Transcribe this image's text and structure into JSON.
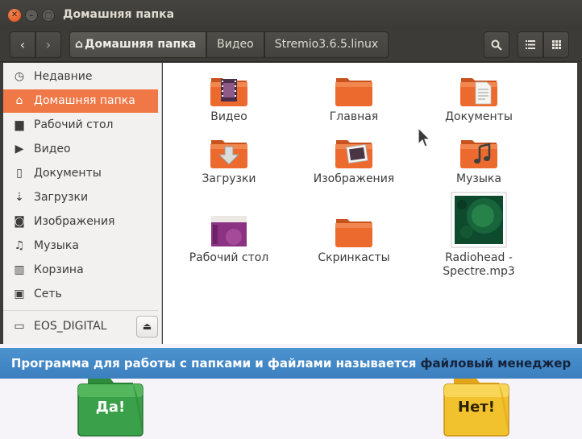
{
  "window": {
    "title": "Домашняя папка",
    "close_glyph": "✕",
    "min_glyph": "–",
    "max_glyph": "□"
  },
  "toolbar": {
    "back_glyph": "‹",
    "forward_glyph": "›",
    "breadcrumbs": [
      "Домашняя папка",
      "Видео",
      "Stremio3.6.5.linux"
    ],
    "home_glyph": "⌂"
  },
  "sidebar": {
    "items": [
      {
        "label": "Недавние",
        "icon": "clock-icon",
        "glyph": "◷"
      },
      {
        "label": "Домашняя папка",
        "icon": "home-icon",
        "glyph": "⌂"
      },
      {
        "label": "Рабочий стол",
        "icon": "desktop-icon",
        "glyph": "▆"
      },
      {
        "label": "Видео",
        "icon": "video-icon",
        "glyph": "▶"
      },
      {
        "label": "Документы",
        "icon": "document-icon",
        "glyph": "▯"
      },
      {
        "label": "Загрузки",
        "icon": "download-icon",
        "glyph": "⇣"
      },
      {
        "label": "Изображения",
        "icon": "camera-icon",
        "glyph": "◙"
      },
      {
        "label": "Музыка",
        "icon": "music-icon",
        "glyph": "♫"
      },
      {
        "label": "Корзина",
        "icon": "trash-icon",
        "glyph": "▥"
      },
      {
        "label": "Сеть",
        "icon": "network-icon",
        "glyph": "▣"
      }
    ],
    "device": {
      "label": "EOS_DIGITAL",
      "icon": "drive-icon",
      "glyph": "▭",
      "eject_glyph": "⏏"
    }
  },
  "files": [
    {
      "label": "Видео",
      "icon": "folder-video-icon"
    },
    {
      "label": "Главная",
      "icon": "folder-icon"
    },
    {
      "label": "Документы",
      "icon": "folder-documents-icon"
    },
    {
      "label": "Загрузки",
      "icon": "folder-downloads-icon"
    },
    {
      "label": "Изображения",
      "icon": "folder-pictures-icon"
    },
    {
      "label": "Музыка",
      "icon": "folder-music-icon"
    },
    {
      "label": "Рабочий стол",
      "icon": "folder-desktop-icon"
    },
    {
      "label": "Скринкасты",
      "icon": "folder-icon"
    },
    {
      "label": "Radiohead - Spectre.mp3",
      "label_line1": "Radiohead -",
      "label_line2": "Spectre.mp3",
      "icon": "audio-file-thumbnail-icon"
    }
  ],
  "banner": {
    "text_before": "Программа для работы с папками и файлами называется ",
    "highlight": "файловый менеджер"
  },
  "answers": {
    "yes": "Да!",
    "no": "Нет!"
  },
  "colors": {
    "accent": "#f07746",
    "folder": "#e8662b",
    "banner": "#3f84c4",
    "yes_folder": "#3aa04a",
    "no_folder": "#f2c22e"
  }
}
